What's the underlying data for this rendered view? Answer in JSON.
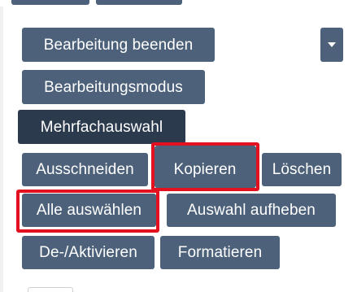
{
  "toolbar": {
    "end_edit_label": "Bearbeitung beenden",
    "edit_mode_label": "Bearbeitungsmodus",
    "multi_select_label": "Mehrfachauswahl",
    "cut_label": "Ausschneiden",
    "copy_label": "Kopieren",
    "delete_label": "Löschen",
    "select_all_label": "Alle auswählen",
    "deselect_label": "Auswahl aufheben",
    "toggle_active_label": "De-/Aktivieren",
    "format_label": "Formatieren",
    "dropdown_icon": "chevron-down-icon"
  },
  "colors": {
    "button": "#4d627a",
    "button_active": "#2b3b4d",
    "highlight": "#e3101f"
  }
}
